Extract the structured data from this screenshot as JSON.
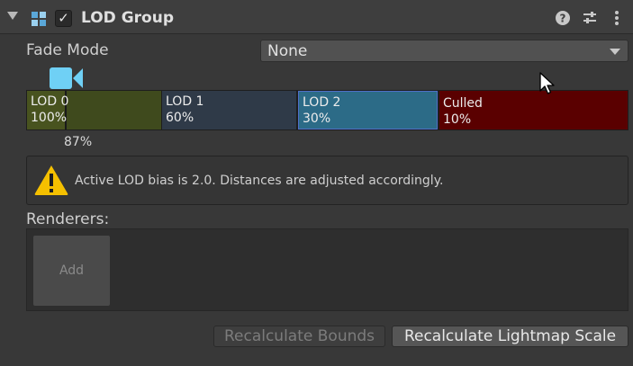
{
  "header": {
    "title": "LOD Group",
    "enabled_checkbox": "✓",
    "icons": [
      "foldout-arrow-icon",
      "lod-group-icon",
      "help-icon",
      "presets-icon",
      "more-menu-icon"
    ]
  },
  "fade_mode": {
    "label": "Fade Mode",
    "value": "None"
  },
  "lod_bar": {
    "camera_marker_percent": "87%",
    "segments": [
      {
        "name": "LOD 0",
        "percent": "100%",
        "color": "#3f4a1d"
      },
      {
        "name": "LOD 1",
        "percent": "60%",
        "color": "#2f3a48"
      },
      {
        "name": "LOD 2",
        "percent": "30%",
        "color": "#2c6b87"
      },
      {
        "name": "Culled",
        "percent": "10%",
        "color": "#5a0000"
      }
    ]
  },
  "warning": {
    "icon": "warning-icon",
    "message": "Active LOD bias is 2.0. Distances are adjusted accordingly."
  },
  "renderers": {
    "label": "Renderers:",
    "add_label": "Add"
  },
  "buttons": {
    "recalculate_bounds": "Recalculate Bounds",
    "recalculate_lightmap_scale": "Recalculate Lightmap Scale"
  },
  "colors": {
    "accent_camera": "#6fd0f5",
    "warning_yellow": "#f5c000"
  }
}
